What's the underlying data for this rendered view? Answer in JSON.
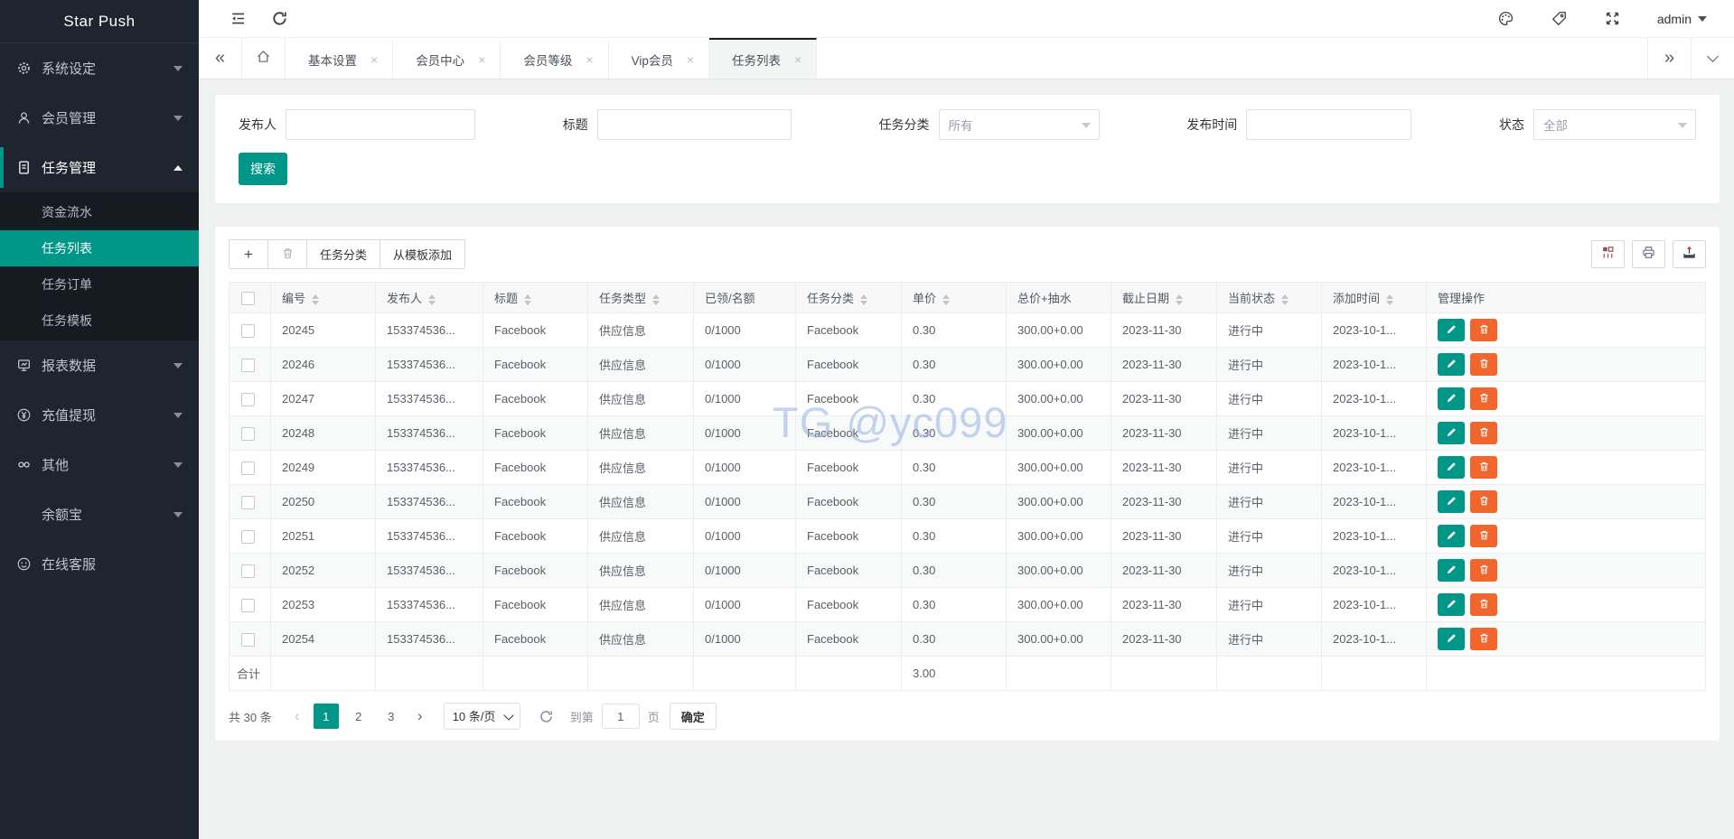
{
  "app": {
    "title": "Star Push",
    "user": "admin"
  },
  "colors": {
    "accent": "#009688",
    "danger": "#f0662d",
    "sidebar_bg": "#1f252e",
    "watermark": "#98b3e2"
  },
  "watermark": "TG @yc099",
  "sidebar": {
    "groups": [
      {
        "name": "system-settings",
        "label": "系统设定",
        "icon": "gear-icon",
        "state": "collapsed"
      },
      {
        "name": "member-management",
        "label": "会员管理",
        "icon": "member-icon",
        "state": "collapsed"
      },
      {
        "name": "task-management",
        "label": "任务管理",
        "icon": "task-icon",
        "state": "expanded",
        "active": true,
        "children": [
          {
            "name": "fund-flow",
            "label": "资金流水"
          },
          {
            "name": "task-list",
            "label": "任务列表",
            "selected": true
          },
          {
            "name": "task-orders",
            "label": "任务订单"
          },
          {
            "name": "task-templates",
            "label": "任务模板"
          }
        ]
      },
      {
        "name": "report-data",
        "label": "报表数据",
        "icon": "report-icon",
        "state": "collapsed"
      },
      {
        "name": "recharge-withdraw",
        "label": "充值提现",
        "icon": "yuan-icon",
        "state": "collapsed"
      },
      {
        "name": "others",
        "label": "其他",
        "icon": "link-icon",
        "state": "collapsed"
      },
      {
        "name": "yuebao",
        "label": "余额宝",
        "icon": null,
        "state": "collapsed"
      },
      {
        "name": "online-support",
        "label": "在线客服",
        "icon": "support-icon",
        "state": "none"
      }
    ]
  },
  "tabs": {
    "items": [
      {
        "name": "tab-basic-settings",
        "label": "基本设置",
        "closable": true
      },
      {
        "name": "tab-member-center",
        "label": "会员中心",
        "closable": true
      },
      {
        "name": "tab-member-level",
        "label": "会员等级",
        "closable": true
      },
      {
        "name": "tab-vip-member",
        "label": "Vip会员",
        "closable": true
      },
      {
        "name": "tab-task-list",
        "label": "任务列表",
        "closable": true,
        "active": true
      }
    ]
  },
  "filters": {
    "fields": [
      {
        "name": "publisher",
        "label": "发布人",
        "control": "input",
        "value": ""
      },
      {
        "name": "title",
        "label": "标题",
        "control": "input",
        "value": ""
      },
      {
        "name": "category",
        "label": "任务分类",
        "control": "select",
        "value": "所有"
      },
      {
        "name": "publish_time",
        "label": "发布时间",
        "control": "input",
        "value": ""
      },
      {
        "name": "status",
        "label": "状态",
        "control": "select",
        "value": "全部"
      }
    ],
    "search_label": "搜索"
  },
  "toolbar": {
    "add_label": "+",
    "category_label": "任务分类",
    "from_template_label": "从模板添加"
  },
  "table": {
    "headers": [
      {
        "key": "id",
        "label": "编号",
        "sortable": true
      },
      {
        "key": "publisher",
        "label": "发布人",
        "sortable": true
      },
      {
        "key": "title",
        "label": "标题",
        "sortable": true
      },
      {
        "key": "task_type",
        "label": "任务类型",
        "sortable": true
      },
      {
        "key": "claimed_quota",
        "label": "已领/名额",
        "sortable": false
      },
      {
        "key": "category",
        "label": "任务分类",
        "sortable": true
      },
      {
        "key": "unit_price",
        "label": "单价",
        "sortable": true
      },
      {
        "key": "total_commission",
        "label": "总价+抽水",
        "sortable": false
      },
      {
        "key": "deadline",
        "label": "截止日期",
        "sortable": true
      },
      {
        "key": "status",
        "label": "当前状态",
        "sortable": true
      },
      {
        "key": "added_time",
        "label": "添加时间",
        "sortable": true
      },
      {
        "key": "actions",
        "label": "管理操作",
        "sortable": false
      }
    ],
    "rows": [
      {
        "id": "20245",
        "publisher": "153374536...",
        "title": "Facebook",
        "task_type": "供应信息",
        "claimed_quota": "0/1000",
        "category": "Facebook",
        "unit_price": "0.30",
        "total_commission": "300.00+0.00",
        "deadline": "2023-11-30",
        "status": "进行中",
        "added_time": "2023-10-1..."
      },
      {
        "id": "20246",
        "publisher": "153374536...",
        "title": "Facebook",
        "task_type": "供应信息",
        "claimed_quota": "0/1000",
        "category": "Facebook",
        "unit_price": "0.30",
        "total_commission": "300.00+0.00",
        "deadline": "2023-11-30",
        "status": "进行中",
        "added_time": "2023-10-1..."
      },
      {
        "id": "20247",
        "publisher": "153374536...",
        "title": "Facebook",
        "task_type": "供应信息",
        "claimed_quota": "0/1000",
        "category": "Facebook",
        "unit_price": "0.30",
        "total_commission": "300.00+0.00",
        "deadline": "2023-11-30",
        "status": "进行中",
        "added_time": "2023-10-1..."
      },
      {
        "id": "20248",
        "publisher": "153374536...",
        "title": "Facebook",
        "task_type": "供应信息",
        "claimed_quota": "0/1000",
        "category": "Facebook",
        "unit_price": "0.30",
        "total_commission": "300.00+0.00",
        "deadline": "2023-11-30",
        "status": "进行中",
        "added_time": "2023-10-1..."
      },
      {
        "id": "20249",
        "publisher": "153374536...",
        "title": "Facebook",
        "task_type": "供应信息",
        "claimed_quota": "0/1000",
        "category": "Facebook",
        "unit_price": "0.30",
        "total_commission": "300.00+0.00",
        "deadline": "2023-11-30",
        "status": "进行中",
        "added_time": "2023-10-1..."
      },
      {
        "id": "20250",
        "publisher": "153374536...",
        "title": "Facebook",
        "task_type": "供应信息",
        "claimed_quota": "0/1000",
        "category": "Facebook",
        "unit_price": "0.30",
        "total_commission": "300.00+0.00",
        "deadline": "2023-11-30",
        "status": "进行中",
        "added_time": "2023-10-1..."
      },
      {
        "id": "20251",
        "publisher": "153374536...",
        "title": "Facebook",
        "task_type": "供应信息",
        "claimed_quota": "0/1000",
        "category": "Facebook",
        "unit_price": "0.30",
        "total_commission": "300.00+0.00",
        "deadline": "2023-11-30",
        "status": "进行中",
        "added_time": "2023-10-1..."
      },
      {
        "id": "20252",
        "publisher": "153374536...",
        "title": "Facebook",
        "task_type": "供应信息",
        "claimed_quota": "0/1000",
        "category": "Facebook",
        "unit_price": "0.30",
        "total_commission": "300.00+0.00",
        "deadline": "2023-11-30",
        "status": "进行中",
        "added_time": "2023-10-1..."
      },
      {
        "id": "20253",
        "publisher": "153374536...",
        "title": "Facebook",
        "task_type": "供应信息",
        "claimed_quota": "0/1000",
        "category": "Facebook",
        "unit_price": "0.30",
        "total_commission": "300.00+0.00",
        "deadline": "2023-11-30",
        "status": "进行中",
        "added_time": "2023-10-1..."
      },
      {
        "id": "20254",
        "publisher": "153374536...",
        "title": "Facebook",
        "task_type": "供应信息",
        "claimed_quota": "0/1000",
        "category": "Facebook",
        "unit_price": "0.30",
        "total_commission": "300.00+0.00",
        "deadline": "2023-11-30",
        "status": "进行中",
        "added_time": "2023-10-1..."
      }
    ],
    "summary": {
      "label": "合计",
      "unit_price_total": "3.00"
    }
  },
  "pagination": {
    "total_label": "共 30 条",
    "pages": [
      "1",
      "2",
      "3"
    ],
    "active_page": "1",
    "page_size_option": "10 条/页",
    "goto_label": "到第",
    "goto_value": "1",
    "page_unit_label": "页",
    "confirm_label": "确定"
  }
}
